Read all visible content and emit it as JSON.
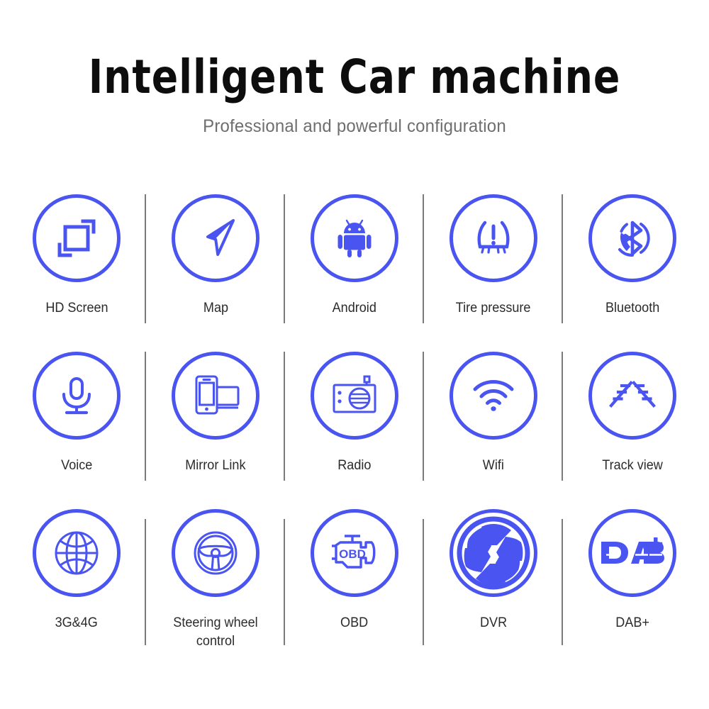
{
  "header": {
    "title": "Intelligent  Car  machine",
    "subtitle": "Professional and powerful configuration"
  },
  "colors": {
    "accent_blue": "#4a54f0",
    "title_black": "#0d0d0d",
    "subtitle_gray": "#6e6e6e",
    "label_dark": "#2b2b2b",
    "divider_gray": "#7b7b7b",
    "background": "#ffffff"
  },
  "features": {
    "rows": [
      [
        {
          "label": "HD Screen",
          "icon": "hd-screen-icon"
        },
        {
          "label": "Map",
          "icon": "navigation-arrow-icon"
        },
        {
          "label": "Android",
          "icon": "android-robot-icon"
        },
        {
          "label": "Tire pressure",
          "icon": "tire-pressure-warning-icon"
        },
        {
          "label": "Bluetooth",
          "icon": "bluetooth-phone-icon"
        }
      ],
      [
        {
          "label": "Voice",
          "icon": "microphone-icon"
        },
        {
          "label": "Mirror Link",
          "icon": "phone-screen-mirror-icon"
        },
        {
          "label": "Radio",
          "icon": "radio-icon"
        },
        {
          "label": "Wifi",
          "icon": "wifi-icon"
        },
        {
          "label": "Track view",
          "icon": "parking-track-lines-icon"
        }
      ],
      [
        {
          "label": "3G&4G",
          "icon": "globe-icon"
        },
        {
          "label": "Steering wheel control",
          "icon": "steering-wheel-icon"
        },
        {
          "label": "OBD",
          "icon": "check-engine-obd-icon"
        },
        {
          "label": "DVR",
          "icon": "camera-aperture-icon"
        },
        {
          "label": "DAB+",
          "icon": "dab-plus-logo-icon"
        }
      ]
    ]
  }
}
